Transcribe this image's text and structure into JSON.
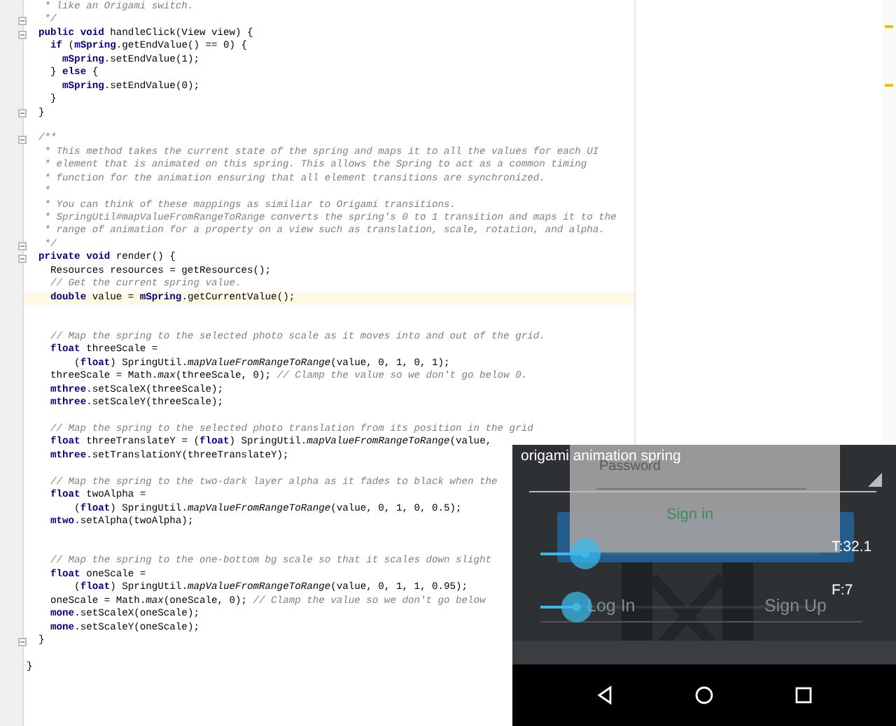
{
  "editor": {
    "lines": [
      {
        "kind": "comment",
        "fold": false,
        "current": false,
        "text": "   * like an Origami switch."
      },
      {
        "kind": "comment",
        "fold": true,
        "current": false,
        "text": "   */"
      },
      {
        "kind": "code",
        "fold": true,
        "current": false,
        "text": "  **public void** handleClick(View view) {"
      },
      {
        "kind": "code",
        "fold": false,
        "current": false,
        "text": "    **if** (**mSpring**.getEndValue() == 0) {"
      },
      {
        "kind": "code",
        "fold": false,
        "current": false,
        "text": "      **mSpring**.setEndValue(1);"
      },
      {
        "kind": "code",
        "fold": false,
        "current": false,
        "text": "    } **else** {"
      },
      {
        "kind": "code",
        "fold": false,
        "current": false,
        "text": "      **mSpring**.setEndValue(0);"
      },
      {
        "kind": "code",
        "fold": false,
        "current": false,
        "text": "    }"
      },
      {
        "kind": "code",
        "fold": true,
        "current": false,
        "text": "  }"
      },
      {
        "kind": "blank"
      },
      {
        "kind": "comment",
        "fold": true,
        "current": false,
        "text": "  /**"
      },
      {
        "kind": "comment",
        "fold": false,
        "current": false,
        "text": "   * This method takes the current state of the spring and maps it to all the values for each UI"
      },
      {
        "kind": "comment",
        "fold": false,
        "current": false,
        "text": "   * element that is animated on this spring. This allows the Spring to act as a common timing"
      },
      {
        "kind": "comment",
        "fold": false,
        "current": false,
        "text": "   * function for the animation ensuring that all element transitions are synchronized."
      },
      {
        "kind": "comment",
        "fold": false,
        "current": false,
        "text": "   *"
      },
      {
        "kind": "comment",
        "fold": false,
        "current": false,
        "text": "   * You can think of these mappings as similiar to Origami transitions."
      },
      {
        "kind": "comment",
        "fold": false,
        "current": false,
        "text": "   * SpringUtil#mapValueFromRangeToRange converts the spring's 0 to 1 transition and maps it to the"
      },
      {
        "kind": "comment",
        "fold": false,
        "current": false,
        "text": "   * range of animation for a property on a view such as translation, scale, rotation, and alpha."
      },
      {
        "kind": "comment",
        "fold": true,
        "current": false,
        "text": "   */"
      },
      {
        "kind": "code",
        "fold": true,
        "current": false,
        "text": "  **private void** render() {"
      },
      {
        "kind": "code",
        "fold": false,
        "current": false,
        "text": "    Resources resources = getResources();"
      },
      {
        "kind": "comment",
        "fold": false,
        "current": false,
        "text": "    // Get the current spring value."
      },
      {
        "kind": "code",
        "fold": false,
        "current": true,
        "text": "    **double** value = **mSpring**.getCurrentValue();"
      },
      {
        "kind": "blank"
      },
      {
        "kind": "blank"
      },
      {
        "kind": "comment",
        "fold": false,
        "current": false,
        "text": "    // Map the spring to the selected photo scale as it moves into and out of the grid."
      },
      {
        "kind": "code",
        "fold": false,
        "current": false,
        "text": "    **float** threeScale ="
      },
      {
        "kind": "code",
        "fold": false,
        "current": false,
        "text": "        (**float**) SpringUtil.*mapValueFromRangeToRange*(value, 0, 1, 0, 1);"
      },
      {
        "kind": "code",
        "fold": false,
        "current": false,
        "text": "    threeScale = Math.*max*(threeScale, 0); ",
        "comment": "// Clamp the value so we don't go below 0."
      },
      {
        "kind": "code",
        "fold": false,
        "current": false,
        "text": "    **mthree**.setScaleX(threeScale);"
      },
      {
        "kind": "code",
        "fold": false,
        "current": false,
        "text": "    **mthree**.setScaleY(threeScale);"
      },
      {
        "kind": "blank"
      },
      {
        "kind": "comment",
        "fold": false,
        "current": false,
        "text": "    // Map the spring to the selected photo translation from its position in the grid"
      },
      {
        "kind": "code",
        "fold": false,
        "current": false,
        "text": "    **float** threeTranslateY = (**float**) SpringUtil.*mapValueFromRangeToRange*(value,"
      },
      {
        "kind": "code",
        "fold": false,
        "current": false,
        "text": "    **mthree**.setTranslationY(threeTranslateY);"
      },
      {
        "kind": "blank"
      },
      {
        "kind": "comment",
        "fold": false,
        "current": false,
        "text": "    // Map the spring to the two-dark layer alpha as it fades to black when the"
      },
      {
        "kind": "code",
        "fold": false,
        "current": false,
        "text": "    **float** twoAlpha ="
      },
      {
        "kind": "code",
        "fold": false,
        "current": false,
        "text": "        (**float**) SpringUtil.*mapValueFromRangeToRange*(value, 0, 1, 0, 0.5);"
      },
      {
        "kind": "code",
        "fold": false,
        "current": false,
        "text": "    **mtwo**.setAlpha(twoAlpha);"
      },
      {
        "kind": "blank"
      },
      {
        "kind": "blank"
      },
      {
        "kind": "comment",
        "fold": false,
        "current": false,
        "text": "    // Map the spring to the one-bottom bg scale so that it scales down slight"
      },
      {
        "kind": "code",
        "fold": false,
        "current": false,
        "text": "    **float** oneScale ="
      },
      {
        "kind": "code",
        "fold": false,
        "current": false,
        "text": "        (**float**) SpringUtil.*mapValueFromRangeToRange*(value, 0, 1, 1, 0.95);"
      },
      {
        "kind": "code",
        "fold": false,
        "current": false,
        "text": "    oneScale = Math.*max*(oneScale, 0); ",
        "comment": "// Clamp the value so we don't go below"
      },
      {
        "kind": "code",
        "fold": false,
        "current": false,
        "text": "    **mone**.setScaleX(oneScale);"
      },
      {
        "kind": "code",
        "fold": false,
        "current": false,
        "text": "    **mone**.setScaleY(oneScale);"
      },
      {
        "kind": "code",
        "fold": true,
        "current": false,
        "text": "  }"
      },
      {
        "kind": "blank"
      },
      {
        "kind": "code",
        "fold": false,
        "current": false,
        "text": "}"
      }
    ]
  },
  "phone": {
    "title": "origami animation spring",
    "password_placeholder": "Password",
    "sign_in": "Sign in",
    "sliders": [
      {
        "label": "T:32.1",
        "level": 0.16
      },
      {
        "label": "F:7",
        "level": 0.13
      }
    ],
    "log_in": "Log In",
    "sign_up": "Sign Up"
  }
}
